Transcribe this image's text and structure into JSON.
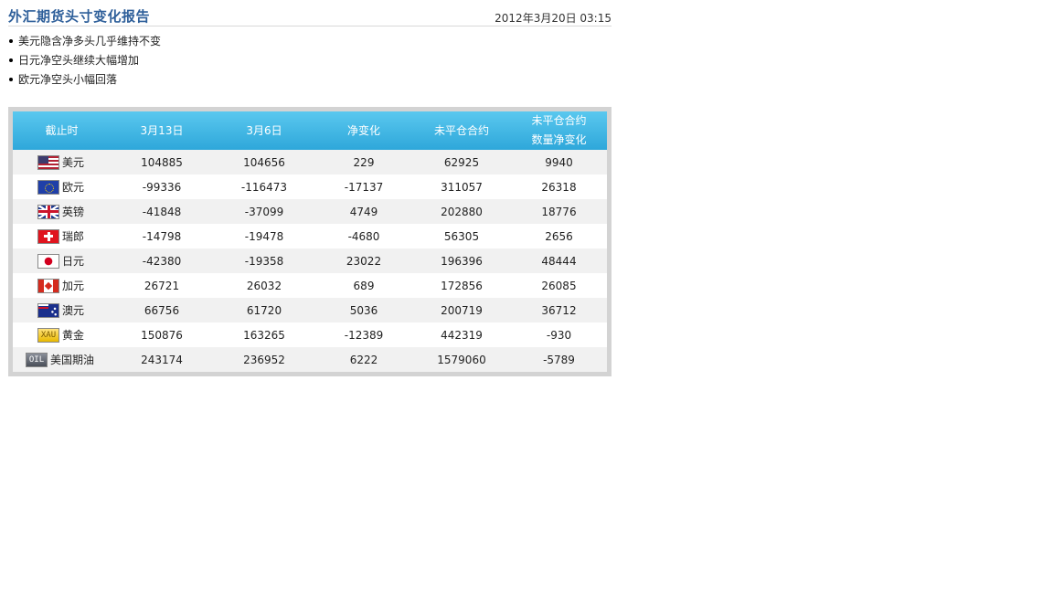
{
  "header": {
    "title": "外汇期货头寸变化报告",
    "datetime": "2012年3月20日 03:15"
  },
  "bullets": [
    "美元隐含净多头几乎维持不变",
    "日元净空头继续大幅增加",
    "欧元净空头小幅回落"
  ],
  "table": {
    "columns": {
      "deadline": "截止时",
      "mar13": "3月13日",
      "mar6": "3月6日",
      "net_change": "净变化",
      "open_interest": "未平仓合约",
      "oi_change_line1": "未平仓合约",
      "oi_change_line2": "数量净变化"
    },
    "rows": [
      {
        "name": "美元",
        "icon": "us-flag-icon",
        "mar13": "104885",
        "mar6": "104656",
        "net_change": "229",
        "open_interest": "62925",
        "oi_change": "9940"
      },
      {
        "name": "欧元",
        "icon": "eu-flag-icon",
        "mar13": "-99336",
        "mar6": "-116473",
        "net_change": "-17137",
        "open_interest": "311057",
        "oi_change": "26318"
      },
      {
        "name": "英镑",
        "icon": "uk-flag-icon",
        "mar13": "-41848",
        "mar6": "-37099",
        "net_change": "4749",
        "open_interest": "202880",
        "oi_change": "18776"
      },
      {
        "name": "瑞郎",
        "icon": "swiss-flag-icon",
        "mar13": "-14798",
        "mar6": "-19478",
        "net_change": "-4680",
        "open_interest": "56305",
        "oi_change": "2656"
      },
      {
        "name": "日元",
        "icon": "japan-flag-icon",
        "mar13": "-42380",
        "mar6": "-19358",
        "net_change": "23022",
        "open_interest": "196396",
        "oi_change": "48444"
      },
      {
        "name": "加元",
        "icon": "canada-flag-icon",
        "mar13": "26721",
        "mar6": "26032",
        "net_change": "689",
        "open_interest": "172856",
        "oi_change": "26085"
      },
      {
        "name": "澳元",
        "icon": "australia-flag-icon",
        "mar13": "66756",
        "mar6": "61720",
        "net_change": "5036",
        "open_interest": "200719",
        "oi_change": "36712"
      },
      {
        "name": "黄金",
        "icon": "gold-xau-icon",
        "icon_text": "XAU",
        "mar13": "150876",
        "mar6": "163265",
        "net_change": "-12389",
        "open_interest": "442319",
        "oi_change": "-930"
      },
      {
        "name": "美国期油",
        "icon": "oil-icon",
        "icon_text": "OIL",
        "mar13": "243174",
        "mar6": "236952",
        "net_change": "6222",
        "open_interest": "1579060",
        "oi_change": "-5789"
      }
    ]
  },
  "colors": {
    "title": "#2e5f9a",
    "header_top": "#5ac8ef",
    "header_bottom": "#2ea7da",
    "row_alt": "#f1f1f1",
    "panel_border": "#d3d3d3"
  }
}
